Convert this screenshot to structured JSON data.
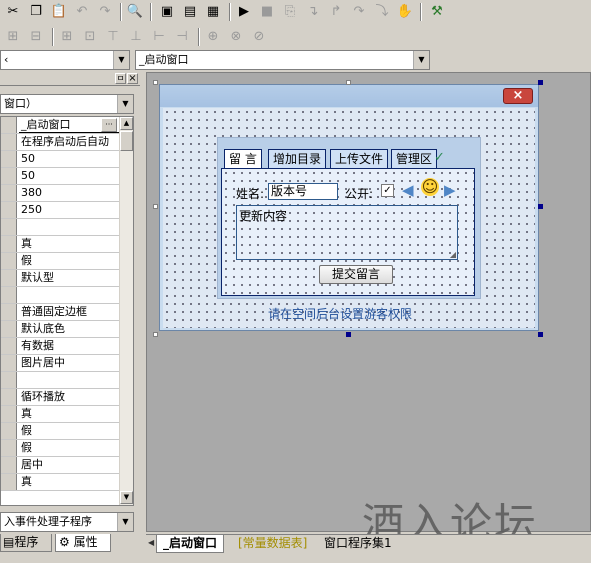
{
  "toolbar": {
    "row1_icons": [
      "cut-icon",
      "copy-icon",
      "paste-icon",
      "undo-icon",
      "redo-icon",
      "find-icon",
      "layout-1-icon",
      "layout-2-icon",
      "layout-3-icon",
      "run-icon",
      "stop-icon",
      "step-icon",
      "step-into-icon",
      "step-out-icon",
      "step-over-icon",
      "run-to-icon",
      "hand-icon",
      "compile-icon"
    ],
    "row2_icons": [
      "align-left-icon",
      "align-center-icon",
      "align-right-icon",
      "same-width-icon",
      "same-height-icon",
      "same-size-icon",
      "hspace-icon",
      "vspace-icon",
      "center-icon"
    ]
  },
  "combos": {
    "left_value": "‹",
    "right_value": "_启动窗口"
  },
  "panel": {
    "object_combo": "窗口）",
    "selected_name": "_启动窗口",
    "ellipsis": "···",
    "properties": [
      {
        "value": "_启动窗口",
        "selected": true
      },
      {
        "value": "在程序启动后自动"
      },
      {
        "value": "50"
      },
      {
        "value": "50"
      },
      {
        "value": "380"
      },
      {
        "value": "250"
      },
      {
        "value": ""
      },
      {
        "value": "真"
      },
      {
        "value": "假"
      },
      {
        "value": "默认型"
      },
      {
        "value": ""
      },
      {
        "value": "普通固定边框"
      },
      {
        "value": "默认底色"
      },
      {
        "value": "有数据"
      },
      {
        "value": "图片居中"
      },
      {
        "value": ""
      },
      {
        "value": "循环播放"
      },
      {
        "value": "真"
      },
      {
        "value": "假"
      },
      {
        "value": "假"
      },
      {
        "value": "居中"
      },
      {
        "value": "真"
      }
    ],
    "event_combo": "入事件处理子程序",
    "tab_program": "程序",
    "tab_property": "属性",
    "pin_label": "ㅁ",
    "close_label": "×"
  },
  "form": {
    "close_label": "×",
    "tabs": [
      "留 言",
      "增加目录",
      "上传文件",
      "管理区"
    ],
    "name_label": "姓名:",
    "name_value": "版本号",
    "public_label": "公开:",
    "content_text": "更新内容",
    "submit_label": "提交留言",
    "footer_text": "请在空间后台设置游客权限",
    "smiley": "☺"
  },
  "bottom_tabs": [
    "_启动窗口",
    "[常量数据表]",
    "窗口程序集1"
  ],
  "watermark": "酒入论坛"
}
